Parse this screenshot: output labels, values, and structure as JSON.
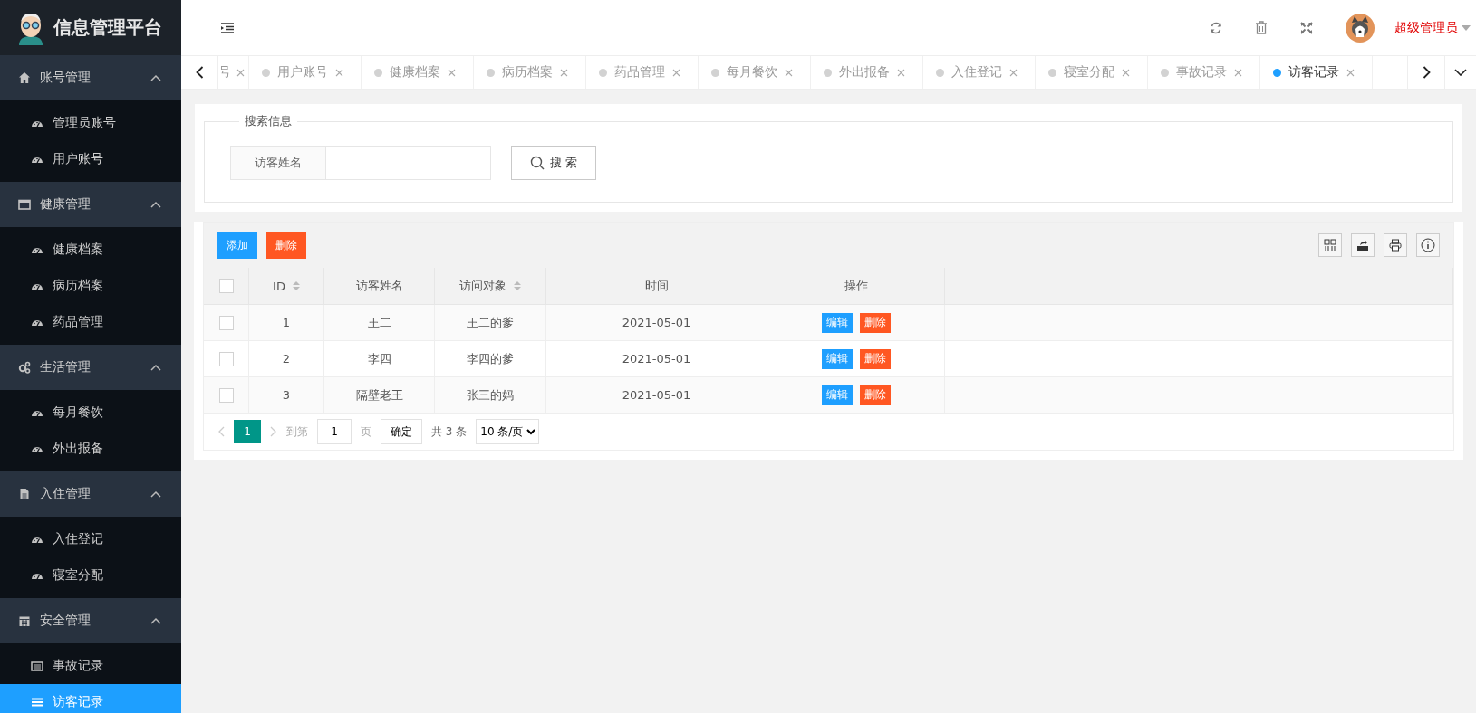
{
  "app": {
    "title": "信息管理平台"
  },
  "sidebar": {
    "groups": [
      {
        "label": "账号管理",
        "expanded": true,
        "items": [
          {
            "label": "管理员账号",
            "selected": false
          },
          {
            "label": "用户账号",
            "selected": false
          }
        ]
      },
      {
        "label": "健康管理",
        "expanded": true,
        "items": [
          {
            "label": "健康档案",
            "selected": false
          },
          {
            "label": "病历档案",
            "selected": false
          },
          {
            "label": "药品管理",
            "selected": false
          }
        ]
      },
      {
        "label": "生活管理",
        "expanded": true,
        "items": [
          {
            "label": "每月餐饮",
            "selected": false
          },
          {
            "label": "外出报备",
            "selected": false
          }
        ]
      },
      {
        "label": "入住管理",
        "expanded": true,
        "items": [
          {
            "label": "入住登记",
            "selected": false
          },
          {
            "label": "寝室分配",
            "selected": false
          }
        ]
      },
      {
        "label": "安全管理",
        "expanded": true,
        "items": [
          {
            "label": "事故记录",
            "selected": false
          },
          {
            "label": "访客记录",
            "selected": true
          }
        ]
      }
    ]
  },
  "header": {
    "user": "超级管理员"
  },
  "tabs": [
    {
      "label": "号",
      "selected": false,
      "cut": true
    },
    {
      "label": "用户账号",
      "selected": false,
      "cut": false
    },
    {
      "label": "健康档案",
      "selected": false,
      "cut": false
    },
    {
      "label": "病历档案",
      "selected": false,
      "cut": false
    },
    {
      "label": "药品管理",
      "selected": false,
      "cut": false
    },
    {
      "label": "每月餐饮",
      "selected": false,
      "cut": false
    },
    {
      "label": "外出报备",
      "selected": false,
      "cut": false
    },
    {
      "label": "入住登记",
      "selected": false,
      "cut": false
    },
    {
      "label": "寝室分配",
      "selected": false,
      "cut": false
    },
    {
      "label": "事故记录",
      "selected": false,
      "cut": false
    },
    {
      "label": "访客记录",
      "selected": true,
      "cut": false
    }
  ],
  "search": {
    "legend": "搜索信息",
    "field_label": "访客姓名",
    "button": "搜 索"
  },
  "toolbar": {
    "buttons": [
      {
        "label": "添加",
        "kind": "primary"
      },
      {
        "label": "删除",
        "kind": "danger"
      }
    ]
  },
  "table": {
    "all_checked": false,
    "columns": [
      {
        "label": "ID",
        "sortable": true
      },
      {
        "label": "访客姓名",
        "sortable": false
      },
      {
        "label": "访问对象",
        "sortable": true
      },
      {
        "label": "时间",
        "sortable": false
      },
      {
        "label": "操作",
        "sortable": false
      }
    ],
    "rows": [
      {
        "checked": false,
        "cells": [
          "1",
          "王二",
          "王二的爹",
          "2021-05-01"
        ],
        "actions": [
          {
            "label": "编辑",
            "kind": "primary"
          },
          {
            "label": "删除",
            "kind": "danger"
          }
        ]
      },
      {
        "checked": false,
        "cells": [
          "2",
          "李四",
          "李四的爹",
          "2021-05-01"
        ],
        "actions": [
          {
            "label": "编辑",
            "kind": "primary"
          },
          {
            "label": "删除",
            "kind": "danger"
          }
        ]
      },
      {
        "checked": false,
        "cells": [
          "3",
          "隔壁老王",
          "张三的妈",
          "2021-05-01"
        ],
        "actions": [
          {
            "label": "编辑",
            "kind": "primary"
          },
          {
            "label": "删除",
            "kind": "danger"
          }
        ]
      }
    ]
  },
  "pagination": {
    "current": "1",
    "goto_label": "到第",
    "goto_value": "1",
    "page_label": "页",
    "confirm": "确定",
    "total": "共 3 条",
    "page_size": "10 条/页"
  }
}
